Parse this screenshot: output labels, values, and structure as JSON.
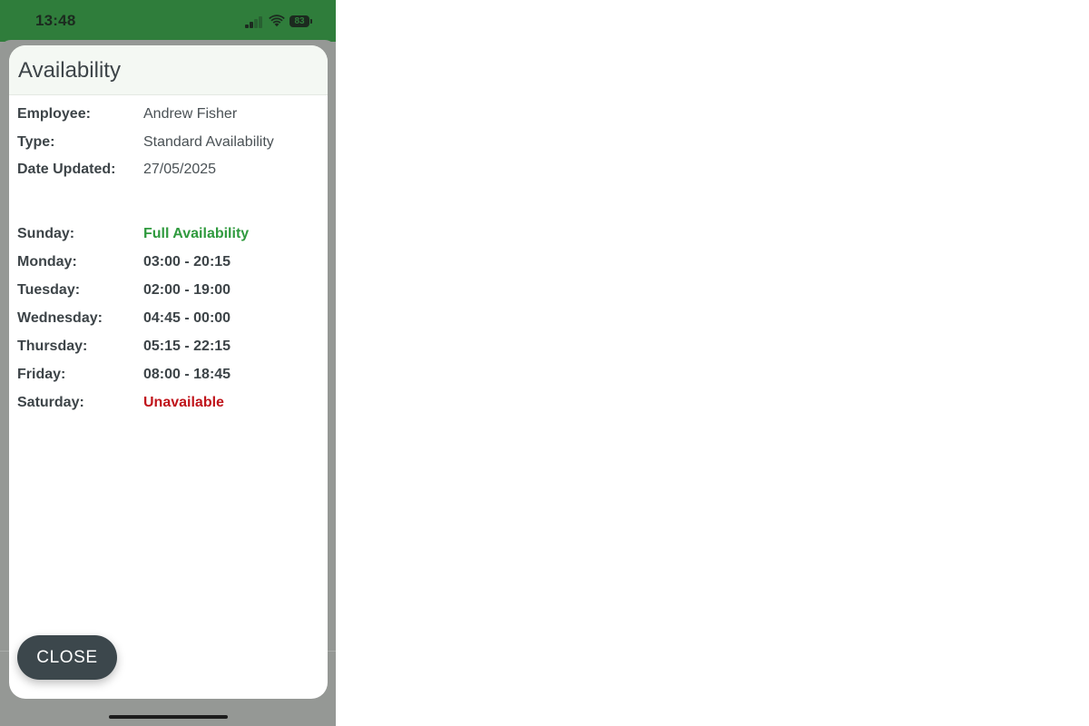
{
  "status_bar": {
    "time": "13:48",
    "battery_level": "83",
    "icons": [
      "signal-icon",
      "wifi-icon",
      "battery-icon"
    ],
    "background_color": "#2f7d3b"
  },
  "modal": {
    "title": "Availability",
    "details": [
      {
        "label": "Employee:",
        "value": "Andrew Fisher"
      },
      {
        "label": "Type:",
        "value": "Standard Availability"
      },
      {
        "label": "Date Updated:",
        "value": "27/05/2025"
      }
    ],
    "schedule": [
      {
        "day": "Sunday:",
        "value": "Full Availability",
        "status_color": "#2f9a3e"
      },
      {
        "day": "Monday:",
        "value": "03:00 - 20:15"
      },
      {
        "day": "Tuesday:",
        "value": "02:00 - 19:00"
      },
      {
        "day": "Wednesday:",
        "value": "04:45 - 00:00"
      },
      {
        "day": "Thursday:",
        "value": "05:15 - 22:15"
      },
      {
        "day": "Friday:",
        "value": "08:00 - 18:45"
      },
      {
        "day": "Saturday:",
        "value": "Unavailable",
        "status_color": "#c0141b"
      }
    ],
    "close_label": "CLOSE"
  }
}
